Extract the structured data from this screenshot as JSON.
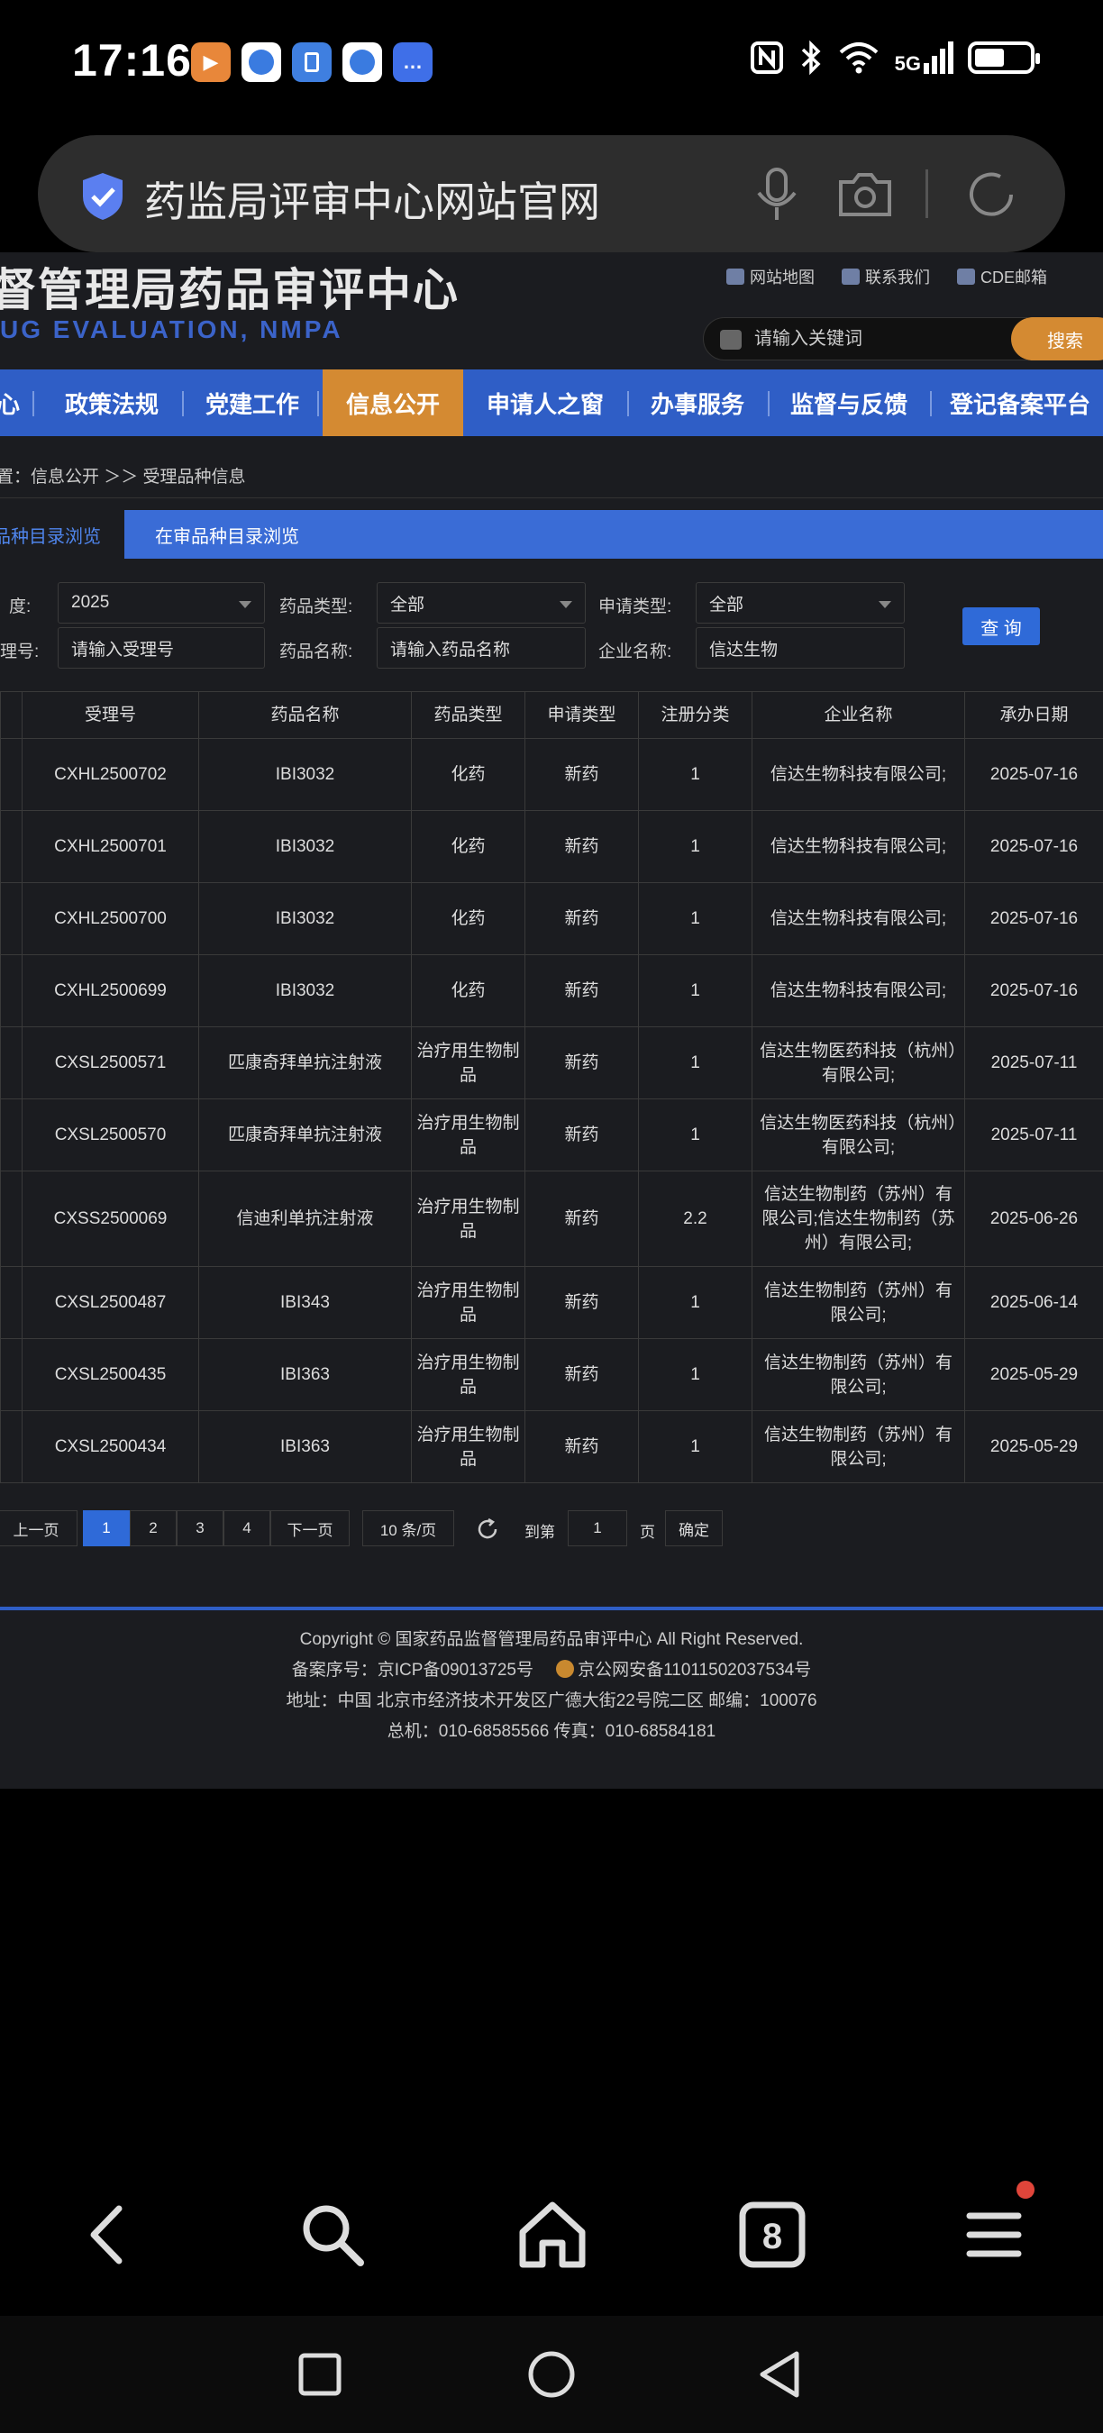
{
  "status_bar": {
    "time": "17:16",
    "network": "5G",
    "battery_level": 0.55,
    "app_icons": [
      "video-app-icon",
      "browser-app-icon",
      "files-app-icon",
      "browser-app-icon",
      "messages-app-icon"
    ]
  },
  "address_bar": {
    "text": "药监局评审中心网站官网"
  },
  "site": {
    "title": "督管理局药品审评中心",
    "subtitle": "UG EVALUATION, NMPA",
    "top_links": [
      "网站地图",
      "联系我们",
      "CDE邮箱"
    ],
    "search": {
      "placeholder": "请输入关键词",
      "button": "搜索"
    },
    "nav": [
      "心",
      "政策法规",
      "党建工作",
      "信息公开",
      "申请人之窗",
      "办事服务",
      "监督与反馈",
      "登记备案平台"
    ],
    "nav_active": "信息公开",
    "breadcrumb": "置：信息公开 ＞＞ 受理品种信息",
    "tabs": [
      "品种目录浏览",
      "在审品种目录浏览"
    ]
  },
  "filters": {
    "year_label": "度:",
    "year_value": "2025",
    "drug_type_label": "药品类型:",
    "drug_type_value": "全部",
    "apply_type_label": "申请类型:",
    "apply_type_value": "全部",
    "accept_no_label": "理号:",
    "accept_no_placeholder": "请输入受理号",
    "drug_name_label": "药品名称:",
    "drug_name_placeholder": "请输入药品名称",
    "company_label": "企业名称:",
    "company_value": "信达生物",
    "query_button": "查 询"
  },
  "table": {
    "headers": [
      "受理号",
      "药品名称",
      "药品类型",
      "申请类型",
      "注册分类",
      "企业名称",
      "承办日期"
    ],
    "rows": [
      [
        "CXHL2500702",
        "IBI3032",
        "化药",
        "新药",
        "1",
        "信达生物科技有限公司;",
        "2025-07-16"
      ],
      [
        "CXHL2500701",
        "IBI3032",
        "化药",
        "新药",
        "1",
        "信达生物科技有限公司;",
        "2025-07-16"
      ],
      [
        "CXHL2500700",
        "IBI3032",
        "化药",
        "新药",
        "1",
        "信达生物科技有限公司;",
        "2025-07-16"
      ],
      [
        "CXHL2500699",
        "IBI3032",
        "化药",
        "新药",
        "1",
        "信达生物科技有限公司;",
        "2025-07-16"
      ],
      [
        "CXSL2500571",
        "匹康奇拜单抗注射液",
        "治疗用生物制品",
        "新药",
        "1",
        "信达生物医药科技（杭州）有限公司;",
        "2025-07-11"
      ],
      [
        "CXSL2500570",
        "匹康奇拜单抗注射液",
        "治疗用生物制品",
        "新药",
        "1",
        "信达生物医药科技（杭州）有限公司;",
        "2025-07-11"
      ],
      [
        "CXSS2500069",
        "信迪利单抗注射液",
        "治疗用生物制品",
        "新药",
        "2.2",
        "信达生物制药（苏州）有限公司;信达生物制药（苏州）有限公司;",
        "2025-06-26"
      ],
      [
        "CXSL2500487",
        "IBI343",
        "治疗用生物制品",
        "新药",
        "1",
        "信达生物制药（苏州）有限公司;",
        "2025-06-14"
      ],
      [
        "CXSL2500435",
        "IBI363",
        "治疗用生物制品",
        "新药",
        "1",
        "信达生物制药（苏州）有限公司;",
        "2025-05-29"
      ],
      [
        "CXSL2500434",
        "IBI363",
        "治疗用生物制品",
        "新药",
        "1",
        "信达生物制药（苏州）有限公司;",
        "2025-05-29"
      ]
    ]
  },
  "pagination": {
    "prev": "上一页",
    "pages": [
      "1",
      "2",
      "3",
      "4"
    ],
    "active_page": "1",
    "next": "下一页",
    "page_size": "10 条/页",
    "goto_label": "到第",
    "goto_value": "1",
    "page_suffix": "页",
    "confirm": "确定"
  },
  "footer": {
    "copyright": "Copyright © 国家药品监督管理局药品审评中心    All Right Reserved.",
    "icp": "备案序号：京ICP备09013725号",
    "police": "京公网安备11011502037534号",
    "address": "地址：中国 北京市经济技术开发区广德大街22号院二区      邮编：100076",
    "phone": "总机：010-68585566      传真：010-68584181"
  }
}
